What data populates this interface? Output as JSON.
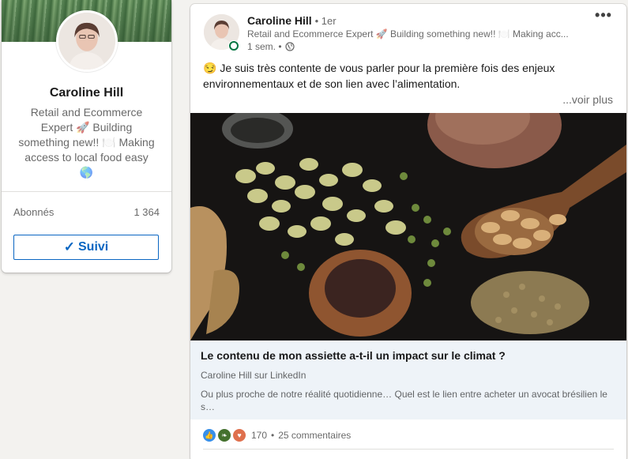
{
  "profile_card": {
    "name": "Caroline Hill",
    "headline": "Retail and Ecommerce Expert 🚀 Building something new!! 🍽️ Making access to local food easy 🌎",
    "followers_label": "Abonnés",
    "followers_count": "1 364",
    "follow_button_label": "Suivi"
  },
  "post": {
    "author_name": "Caroline Hill",
    "degree": "• 1er",
    "author_headline": "Retail and Ecommerce Expert 🚀 Building something new!! 🍽️ Making acc...",
    "time": "1 sem. •",
    "text": "😏 Je suis très contente de vous parler pour la première fois des enjeux environnementaux et de son lien avec l’alimentation.",
    "see_more": "...voir plus",
    "more_options": "•••",
    "article": {
      "title": "Le contenu de mon assiette a-t-il un impact sur le climat ?",
      "source": "Caroline Hill sur LinkedIn",
      "description": "Ou plus proche de notre réalité quotidienne… Quel est le lien entre acheter un avocat brésilien le s…"
    },
    "social": {
      "reactions_count": "170",
      "separator": "•",
      "comments": "25 commentaires"
    }
  },
  "colors": {
    "brand_blue": "#0a66c2",
    "online_green": "#057642",
    "article_bg": "#eef3f8"
  },
  "icons": {
    "globe": "globe-icon",
    "check": "check-icon",
    "like": "like-reaction-icon",
    "support": "support-reaction-icon",
    "love": "love-reaction-icon"
  }
}
